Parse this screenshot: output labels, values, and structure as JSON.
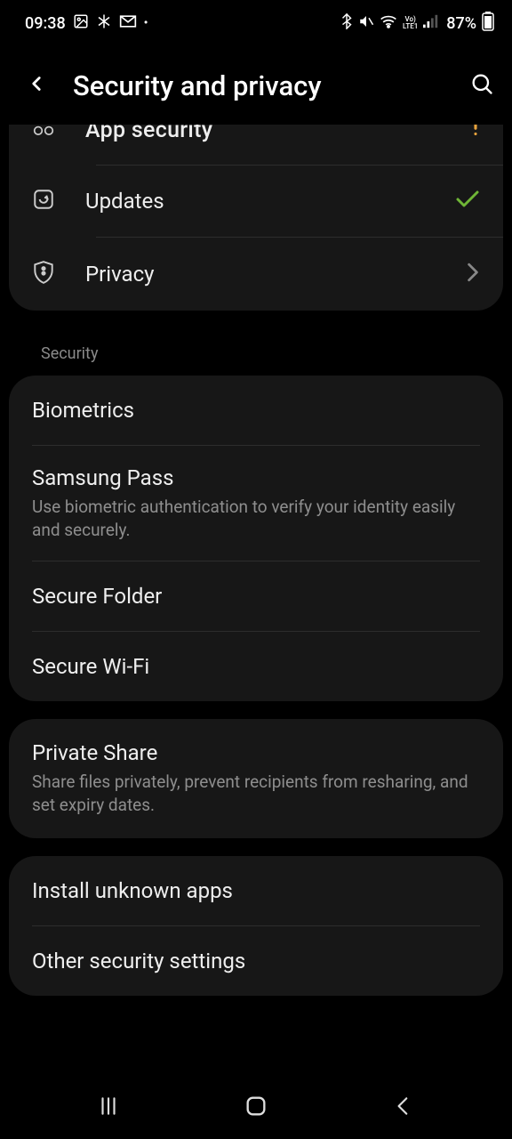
{
  "status": {
    "time": "09:38",
    "battery_pct": "87%"
  },
  "header": {
    "title": "Security and privacy"
  },
  "top_card": {
    "app_security": "App security",
    "updates": "Updates",
    "privacy": "Privacy"
  },
  "section_label_security": "Security",
  "security_card": {
    "biometrics": "Biometrics",
    "samsung_pass": {
      "title": "Samsung Pass",
      "sub": "Use biometric authentication to verify your identity easily and securely."
    },
    "secure_folder": "Secure Folder",
    "secure_wifi": "Secure Wi-Fi"
  },
  "private_share": {
    "title": "Private Share",
    "sub": "Share files privately, prevent recipients from resharing, and set expiry dates."
  },
  "other_card": {
    "install_unknown": "Install unknown apps",
    "other_security": "Other security settings"
  },
  "colors": {
    "card_bg": "#171717",
    "divider": "#2d2d2d",
    "sub_text": "#8e8e8e",
    "check_green": "#8bc34a"
  }
}
